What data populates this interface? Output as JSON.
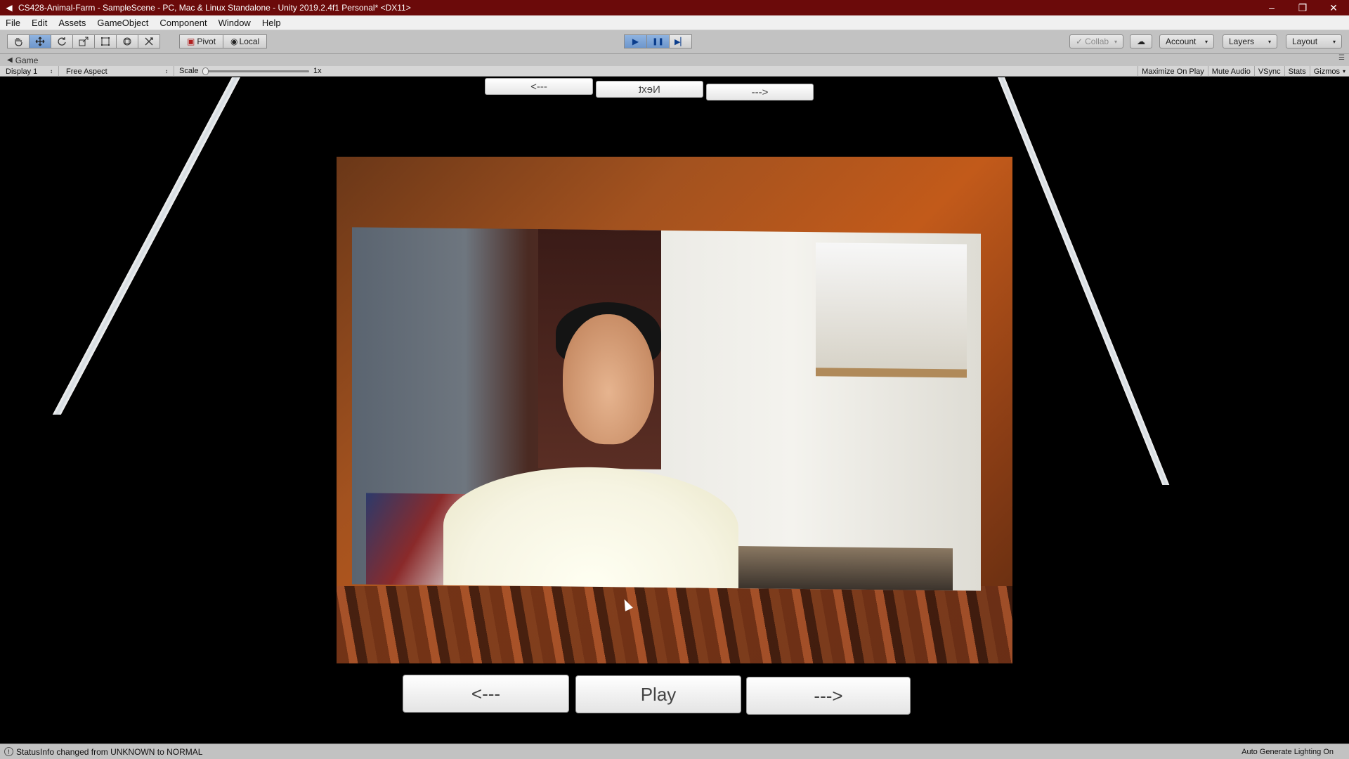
{
  "window": {
    "title": "CS428-Animal-Farm - SampleScene - PC, Mac & Linux Standalone - Unity 2019.2.4f1 Personal* <DX11>",
    "controls": {
      "minimize": "–",
      "restore": "❐",
      "close": "✕"
    }
  },
  "menu": {
    "items": [
      "File",
      "Edit",
      "Assets",
      "GameObject",
      "Component",
      "Window",
      "Help"
    ]
  },
  "toolbar": {
    "tools": [
      "hand-icon",
      "move-icon",
      "rotate-icon",
      "scale-icon",
      "rect-icon",
      "transform-icon",
      "custom-tool-icon"
    ],
    "pivot_label": "Pivot",
    "local_label": "Local",
    "play_icon": "▶",
    "pause_icon": "❚❚",
    "step_icon": "▶▏",
    "collab_label": "Collab",
    "cloud_icon": "☁",
    "account_label": "Account",
    "layers_label": "Layers",
    "layout_label": "Layout",
    "caret": "▾"
  },
  "game_panel": {
    "tab_label": "Game",
    "display_label": "Display 1",
    "aspect_label": "Free Aspect",
    "scale_label": "Scale",
    "scale_value": "1x",
    "right_buttons": [
      "Maximize On Play",
      "Mute Audio",
      "VSync",
      "Stats",
      "Gizmos"
    ]
  },
  "scene": {
    "top_buttons": [
      "<---",
      "Next",
      "--->"
    ],
    "bottom_buttons": [
      "<---",
      "Play",
      "--->"
    ]
  },
  "status": {
    "message": "StatusInfo changed from UNKNOWN to NORMAL",
    "right_text": "Auto Generate Lighting On"
  }
}
